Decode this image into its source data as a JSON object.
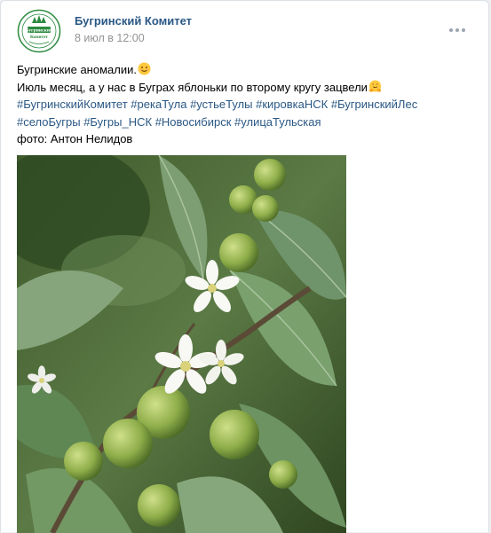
{
  "post": {
    "author": "Бугринский Комитет",
    "date": "8 июл в 12:00",
    "logo_text_1": "Бугринский",
    "logo_text_2": "Комитет",
    "text": {
      "line1": "Бугринские аномалии.",
      "line2": "Июль месяц, а у нас в Буграх яблоньки по второму кругу зацвели",
      "hashtags_line1": [
        "#БугринскийКомитет",
        "#рекаТула",
        "#устьеТулы",
        "#кировкаНСК",
        "#БугринскийЛес"
      ],
      "hashtags_line2": [
        "#селоБугры",
        "#Бугры_НСК",
        "#Новосибирск",
        "#улицаТульская"
      ],
      "photo_credit": "фото: Антон Нелидов"
    },
    "icons": {
      "emoji1": "smiling-face-icon",
      "emoji2": "hugging-face-icon",
      "menu": "more-dots-icon"
    },
    "colors": {
      "link": "#2a5885",
      "date": "#939393",
      "logo_green": "#2b8a3e"
    }
  }
}
